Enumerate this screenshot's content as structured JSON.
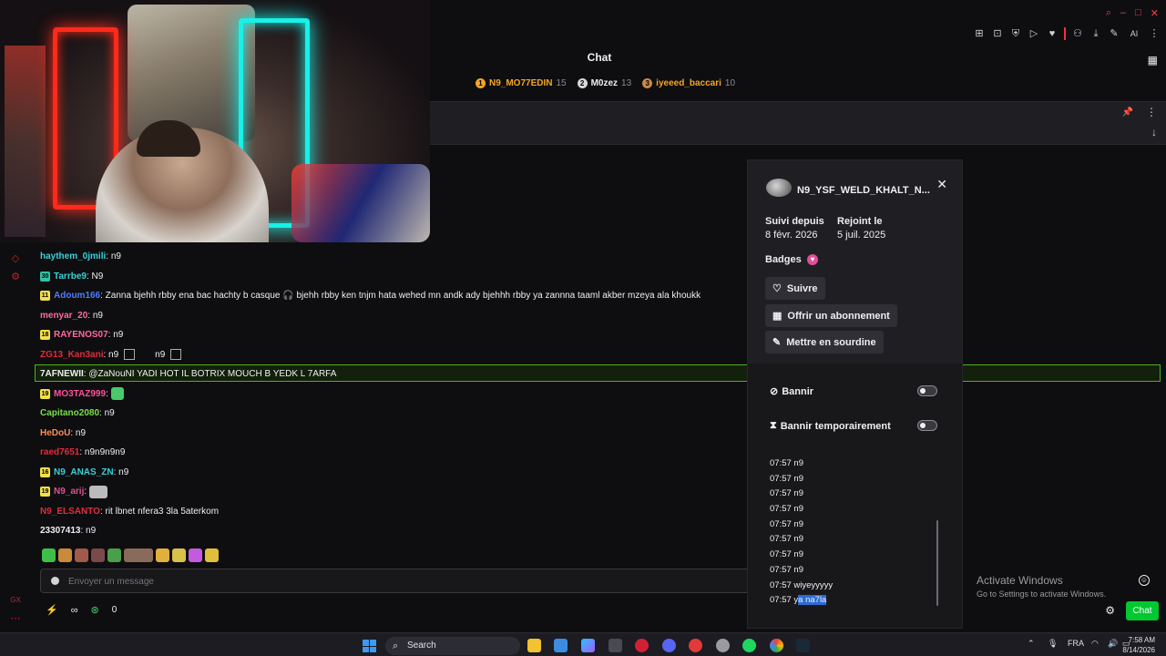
{
  "chat": {
    "title": "Chat",
    "leaderboard": [
      {
        "rank": "1",
        "name": "N9_MO77EDIN",
        "count": "15",
        "name_color": "#f5a623",
        "rank_color": "#f5a623"
      },
      {
        "rank": "2",
        "name": "M0zez",
        "count": "13",
        "name_color": "#efeff1",
        "rank_color": "#d8d8dc"
      },
      {
        "rank": "3",
        "name": "iyeeed_baccari",
        "count": "10",
        "name_color": "#f5a623",
        "rank_color": "#c98a4a"
      }
    ],
    "messages": [
      {
        "badge": "",
        "user": "haythem_0jmili",
        "color": "#3ad1d9",
        "text": ": n9"
      },
      {
        "badge": "30",
        "user": "Tarrbe9",
        "color": "#3ad1d9",
        "text": ": N9",
        "badge_color": "#2ec4a6"
      },
      {
        "badge": "11",
        "user": "Adoum166",
        "color": "#4f7cff",
        "text": ": Zanna bjehh rbby ena bac hachty b casque 🎧 bjehh rbby ken tnjm hata wehed mn andk ady bjehhh rbby ya zannna taaml akber mzeya ala khoukk",
        "badge_color": "#f1e04a"
      },
      {
        "badge": "",
        "user": "menyar_20",
        "color": "#ff6b9c",
        "text": ": n9"
      },
      {
        "badge": "18",
        "user": "RAYENOS07",
        "color": "#ff6b9c",
        "text": ": n9",
        "badge_color": "#f1e04a"
      },
      {
        "badge": "",
        "user": "ZG13_Kan3ani",
        "color": "#e02d3c",
        "text": ": n9",
        "extra": "n9"
      },
      {
        "badge": "",
        "user": "7AFNEWII",
        "color": "#efeff1",
        "text": ": @ZaNouNI YADI HOT IL BOTRIX MOUCH B YEDK L 7ARFA"
      },
      {
        "badge": "19",
        "user": "MO3TAZ999",
        "color": "#ff4f9a",
        "text": ":",
        "badge_color": "#f1e04a"
      },
      {
        "badge": "",
        "user": "Capitano2080",
        "color": "#78e04a",
        "text": ": n9"
      },
      {
        "badge": "",
        "user": "HeDoU",
        "color": "#ff8c5a",
        "text": ": n9"
      },
      {
        "badge": "",
        "user": "raed7651",
        "color": "#e02d3c",
        "text": ": n9n9n9n9"
      },
      {
        "badge": "16",
        "user": "N9_ANAS_ZN",
        "color": "#3ad1d9",
        "text": ": n9",
        "badge_color": "#f1e04a"
      },
      {
        "badge": "19",
        "user": "N9_arij",
        "color": "#e24e98",
        "text": ":",
        "badge_color": "#f1e04a"
      },
      {
        "badge": "",
        "user": "N9_ELSANTO",
        "color": "#e02d3c",
        "text": ": rit lbnet nfera3 3la 5aterkom"
      },
      {
        "badge": "",
        "user": "23307413",
        "color": "#efeff1",
        "text": ": n9"
      }
    ],
    "input_placeholder": "Envoyer un message",
    "points": "0",
    "chat_button": "Chat"
  },
  "user_card": {
    "name": "N9_YSF_WELD_KHALT_N...",
    "followed_label": "Suivi depuis",
    "followed_value": "8 févr. 2026",
    "joined_label": "Rejoint le",
    "joined_value": "5 juil. 2025",
    "badges_label": "Badges",
    "follow_button": "Suivre",
    "gift_button": "Offrir un abonnement",
    "mute_button": "Mettre en sourdine",
    "ban_label": "Bannir",
    "timeout_label": "Bannir temporairement",
    "log": [
      {
        "time": "07:57",
        "text": "n9"
      },
      {
        "time": "07:57",
        "text": "n9"
      },
      {
        "time": "07:57",
        "text": "n9"
      },
      {
        "time": "07:57",
        "text": "n9"
      },
      {
        "time": "07:57",
        "text": "n9"
      },
      {
        "time": "07:57",
        "text": "n9"
      },
      {
        "time": "07:57",
        "text": "n9"
      },
      {
        "time": "07:57",
        "text": "n9"
      },
      {
        "time": "07:57",
        "text": "wiyeyyyyy"
      },
      {
        "time": "07:57",
        "text_plain": "y",
        "text_selected": "a na7la"
      }
    ]
  },
  "watermark": {
    "line1": "Activate Windows",
    "line2": "Go to Settings to activate Windows."
  },
  "taskbar": {
    "search": "Search",
    "lang": "FRA",
    "time": "7:58 AM",
    "date": "8/14/2026"
  }
}
